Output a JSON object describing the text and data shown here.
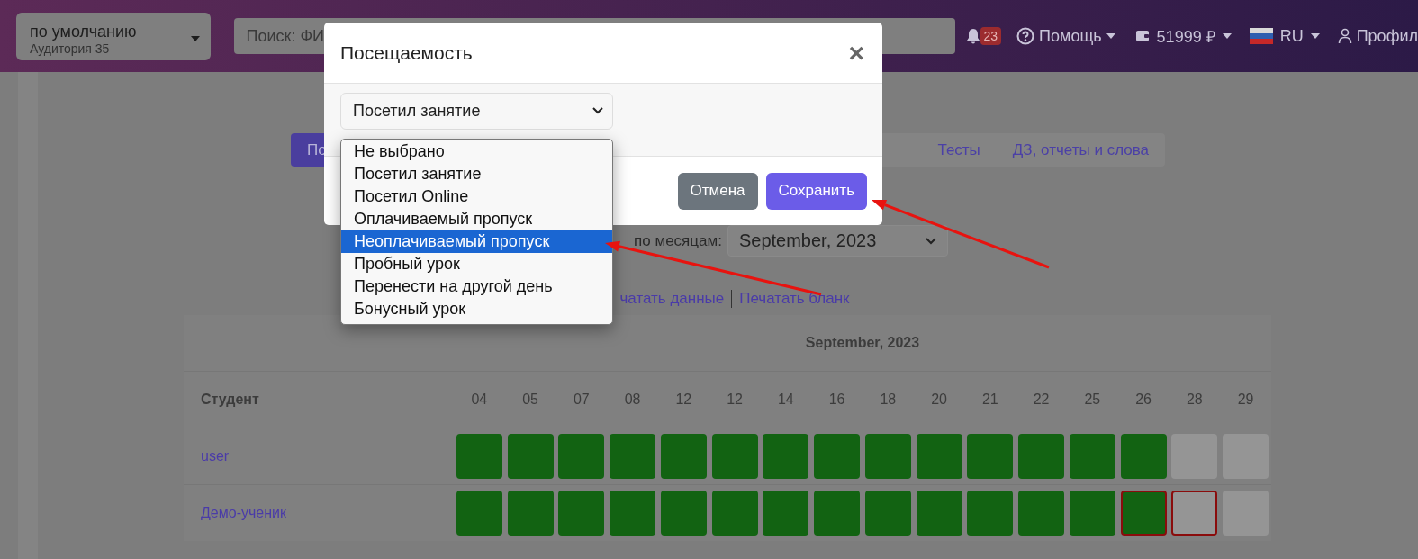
{
  "topbar": {
    "group_select": {
      "value": "по умолчанию",
      "subtitle": "Аудитория 35"
    },
    "search": {
      "placeholder": "Поиск: ФИ"
    },
    "notifications": {
      "count": "23"
    },
    "help": "Помощь",
    "balance": "51999 ₽",
    "language": "RU",
    "profile": "Профил"
  },
  "tabs": [
    {
      "label": "По",
      "selected": true
    },
    {
      "label": "Тесты",
      "selected": false
    },
    {
      "label": "ДЗ, отчеты и слова",
      "selected": false
    }
  ],
  "month_filter": {
    "label": "по месяцам:",
    "value": "September, 2023"
  },
  "print_links": [
    "чатать данные",
    "Печатать бланк"
  ],
  "table": {
    "month": "September, 2023",
    "student_header": "Студент",
    "dates": [
      "04",
      "05",
      "07",
      "08",
      "12",
      "12",
      "14",
      "16",
      "18",
      "20",
      "21",
      "22",
      "25",
      "26",
      "28",
      "29"
    ],
    "rows": [
      {
        "name": "user",
        "cells": [
          {
            "present": true,
            "outlined": false
          },
          {
            "present": true,
            "outlined": false
          },
          {
            "present": true,
            "outlined": false
          },
          {
            "present": true,
            "outlined": false
          },
          {
            "present": true,
            "outlined": false
          },
          {
            "present": true,
            "outlined": false
          },
          {
            "present": true,
            "outlined": false
          },
          {
            "present": true,
            "outlined": false
          },
          {
            "present": true,
            "outlined": false
          },
          {
            "present": true,
            "outlined": false
          },
          {
            "present": true,
            "outlined": false
          },
          {
            "present": true,
            "outlined": false
          },
          {
            "present": true,
            "outlined": false
          },
          {
            "present": true,
            "outlined": false
          },
          {
            "present": false,
            "outlined": false
          },
          {
            "present": false,
            "outlined": false
          }
        ]
      },
      {
        "name": "Демо-ученик",
        "cells": [
          {
            "present": true,
            "outlined": false
          },
          {
            "present": true,
            "outlined": false
          },
          {
            "present": true,
            "outlined": false
          },
          {
            "present": true,
            "outlined": false
          },
          {
            "present": true,
            "outlined": false
          },
          {
            "present": true,
            "outlined": false
          },
          {
            "present": true,
            "outlined": false
          },
          {
            "present": true,
            "outlined": false
          },
          {
            "present": true,
            "outlined": false
          },
          {
            "present": true,
            "outlined": false
          },
          {
            "present": true,
            "outlined": false
          },
          {
            "present": true,
            "outlined": false
          },
          {
            "present": true,
            "outlined": false
          },
          {
            "present": true,
            "outlined": true
          },
          {
            "present": false,
            "outlined": true
          },
          {
            "present": false,
            "outlined": false
          }
        ]
      }
    ]
  },
  "modal": {
    "title": "Посещаемость",
    "close": "×",
    "select": {
      "value": "Посетил занятие"
    },
    "options": [
      {
        "label": "Не выбрано",
        "highlighted": false
      },
      {
        "label": "Посетил занятие",
        "highlighted": false
      },
      {
        "label": "Посетил Online",
        "highlighted": false
      },
      {
        "label": "Оплачиваемый пропуск",
        "highlighted": false
      },
      {
        "label": "Неоплачиваемый пропуск",
        "highlighted": true
      },
      {
        "label": "Пробный урок",
        "highlighted": false
      },
      {
        "label": "Перенести на другой день",
        "highlighted": false
      },
      {
        "label": "Бонусный урок",
        "highlighted": false
      }
    ],
    "buttons": [
      {
        "label": "Отмена",
        "kind": "secondary"
      },
      {
        "label": "Сохранить",
        "kind": "primary"
      }
    ]
  }
}
